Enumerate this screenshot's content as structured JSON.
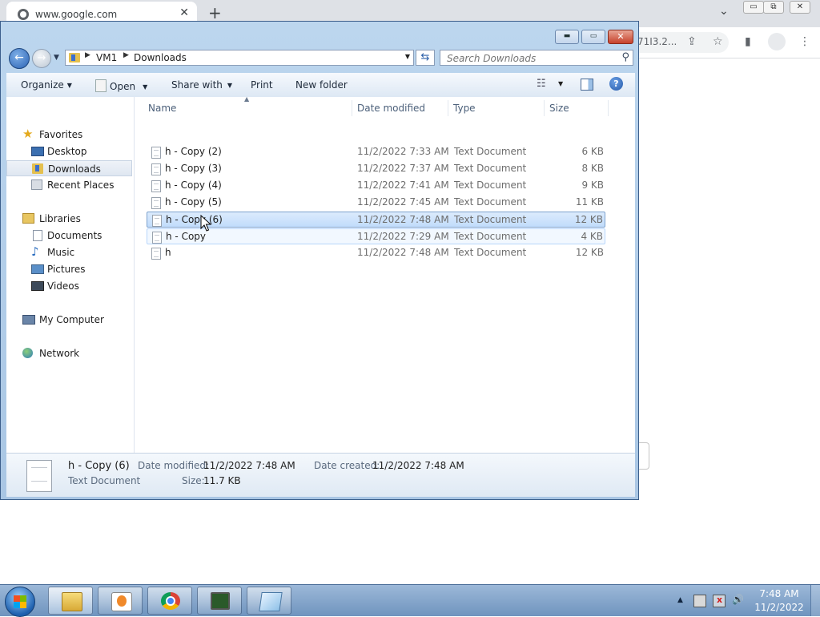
{
  "browser": {
    "tab_title": "www.google.com",
    "tab_close": "✕",
    "new_tab": "+",
    "url_tail": "71I3.2...",
    "window_controls": [
      "▭",
      "⧉",
      "✕"
    ],
    "chevron": "⌄"
  },
  "explorer": {
    "window_buttons": {
      "minimize": "▬",
      "maximize": "▭",
      "close": "✕"
    },
    "nav": {
      "back_glyph": "←",
      "forward_glyph": "→",
      "history_glyph": "▼"
    },
    "address": {
      "crumbs": [
        "VM1",
        "Downloads"
      ],
      "separator": "▶",
      "dropdown_glyph": "▼"
    },
    "refresh_glyph": "⇆",
    "search": {
      "placeholder": "Search Downloads",
      "icon_glyph": "⚲"
    },
    "toolbar": {
      "organize": "Organize",
      "open": "Open",
      "share_with": "Share with",
      "print": "Print",
      "new_folder": "New folder",
      "caret": "▼",
      "views_glyph": "☷",
      "help_glyph": "?"
    },
    "nav_pane": {
      "favorites": "Favorites",
      "desktop": "Desktop",
      "downloads": "Downloads",
      "recent_places": "Recent Places",
      "libraries": "Libraries",
      "documents": "Documents",
      "music": "Music",
      "pictures": "Pictures",
      "videos": "Videos",
      "my_computer": "My Computer",
      "network": "Network",
      "star_glyph": "★",
      "music_glyph": "♪"
    },
    "columns": {
      "name": "Name",
      "date": "Date modified",
      "type": "Type",
      "size": "Size",
      "sort_glyph": "▲"
    },
    "files": [
      {
        "name": "h - Copy (2)",
        "date": "11/2/2022 7:33 AM",
        "type": "Text Document",
        "size": "6 KB"
      },
      {
        "name": "h - Copy (3)",
        "date": "11/2/2022 7:37 AM",
        "type": "Text Document",
        "size": "8 KB"
      },
      {
        "name": "h - Copy (4)",
        "date": "11/2/2022 7:41 AM",
        "type": "Text Document",
        "size": "9 KB"
      },
      {
        "name": "h - Copy (5)",
        "date": "11/2/2022 7:45 AM",
        "type": "Text Document",
        "size": "11 KB"
      },
      {
        "name": "h - Copy (6)",
        "date": "11/2/2022 7:48 AM",
        "type": "Text Document",
        "size": "12 KB"
      },
      {
        "name": "h - Copy",
        "date": "11/2/2022 7:29 AM",
        "type": "Text Document",
        "size": "4 KB"
      },
      {
        "name": "h",
        "date": "11/2/2022 7:48 AM",
        "type": "Text Document",
        "size": "12 KB"
      }
    ],
    "selected_file": "h - Copy (6)",
    "details": {
      "name": "h - Copy (6)",
      "type": "Text Document",
      "date_modified_label": "Date modified:",
      "date_modified": "11/2/2022 7:48 AM",
      "date_created_label": "Date created:",
      "date_created": "11/2/2022 7:48 AM",
      "size_label": "Size:",
      "size": "11.7 KB"
    }
  },
  "taskbar": {
    "clock_time": "7:48 AM",
    "clock_date": "11/2/2022",
    "tray_glyphs": {
      "expand": "▲",
      "volume": "🔊"
    },
    "buttons": [
      "file-explorer",
      "media-player",
      "chrome",
      "monitor-app",
      "notepad"
    ]
  },
  "colors": {
    "window_frame": "#a9c6e4",
    "selection": "#c1dcfb",
    "taskbar": "#6f94be"
  }
}
